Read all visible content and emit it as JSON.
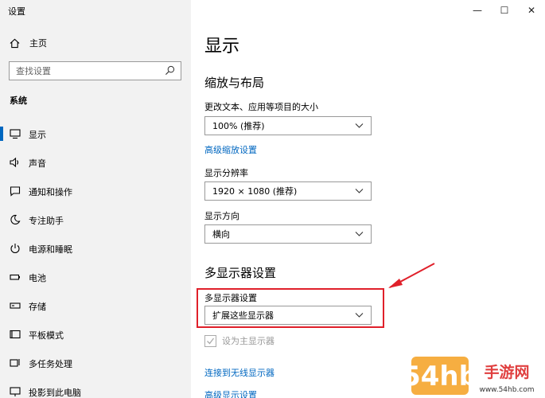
{
  "window": {
    "title": "设置",
    "minimize": "—",
    "maximize": "☐",
    "close": "✕"
  },
  "sidebar": {
    "home_label": "主页",
    "search_placeholder": "查找设置",
    "group_label": "系统",
    "items": [
      {
        "label": "显示",
        "icon": "monitor-icon",
        "active": true
      },
      {
        "label": "声音",
        "icon": "speaker-icon"
      },
      {
        "label": "通知和操作",
        "icon": "notification-icon"
      },
      {
        "label": "专注助手",
        "icon": "moon-icon"
      },
      {
        "label": "电源和睡眠",
        "icon": "power-icon"
      },
      {
        "label": "电池",
        "icon": "battery-icon"
      },
      {
        "label": "存储",
        "icon": "storage-icon"
      },
      {
        "label": "平板模式",
        "icon": "tablet-icon"
      },
      {
        "label": "多任务处理",
        "icon": "multitask-icon"
      },
      {
        "label": "投影到此电脑",
        "icon": "project-icon"
      }
    ]
  },
  "main": {
    "title": "显示",
    "scale_section": "缩放与布局",
    "text_size_label": "更改文本、应用等项目的大小",
    "text_size_value": "100% (推荐)",
    "advanced_scaling_link": "高级缩放设置",
    "resolution_label": "显示分辨率",
    "resolution_value": "1920 × 1080 (推荐)",
    "orientation_label": "显示方向",
    "orientation_value": "横向",
    "multi_section": "多显示器设置",
    "multi_label": "多显示器设置",
    "multi_value": "扩展这些显示器",
    "primary_checkbox": "设为主显示器",
    "wireless_link": "连接到无线显示器",
    "advanced_display_link": "高级显示设置"
  },
  "colors": {
    "accent": "#0067c0",
    "annotation": "#e0202a",
    "sidebar_bg": "#f2f2f2"
  },
  "watermark": {
    "text": "54hb手游网",
    "sub": "www.54hb.com"
  }
}
